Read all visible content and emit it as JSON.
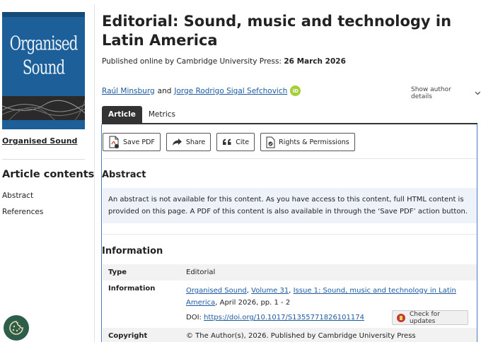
{
  "journal": {
    "cover_title_line1": "Organised",
    "cover_title_line2": "Sound",
    "link_label": "Organised Sound"
  },
  "sidebar": {
    "heading": "Article contents",
    "items": [
      {
        "label": "Abstract"
      },
      {
        "label": "References"
      }
    ]
  },
  "article": {
    "title": "Editorial: Sound, music and technology in Latin America",
    "published_prefix": "Published online by Cambridge University Press:",
    "published_date": "26 March 2026",
    "author1": "Raúl Minsburg",
    "author_joiner": "and",
    "author2": "Jorge Rodrigo Sigal Sefchovich",
    "orcid_label": "iD",
    "show_author_details": "Show author details"
  },
  "tabs": [
    {
      "label": "Article",
      "active": true
    },
    {
      "label": "Metrics",
      "active": false
    }
  ],
  "toolbar": {
    "save_pdf": "Save PDF",
    "share": "Share",
    "cite": "Cite",
    "rights": "Rights & Permissions"
  },
  "abstract": {
    "heading": "Abstract",
    "text": "An abstract is not available for this content. As you have access to this content, full HTML content is provided on this page. A PDF of this content is also available in through the ‘Save PDF’ action button."
  },
  "information": {
    "heading": "Information",
    "type_key": "Type",
    "type_value": "Editorial",
    "info_key": "Information",
    "journal_link": "Organised Sound",
    "volume_link": "Volume 31",
    "issue_link": "Issue 1: Sound, music and technology in Latin America",
    "pages": ", April 2026, pp. 1 - 2",
    "doi_prefix": "DOI:",
    "doi_link": "https://doi.org/10.1017/S1355771826101174",
    "copyright_key": "Copyright",
    "copyright_value": "© The Author(s), 2026. Published by Cambridge University Press"
  },
  "check_updates": "Check for updates",
  "colors": {
    "link": "#1e5aa0",
    "panel_border": "#4a7bc2",
    "tab_active": "#333333",
    "abstract_bg": "#eef3fa",
    "orcid": "#a6ce39",
    "cover": "#1d5f98"
  }
}
